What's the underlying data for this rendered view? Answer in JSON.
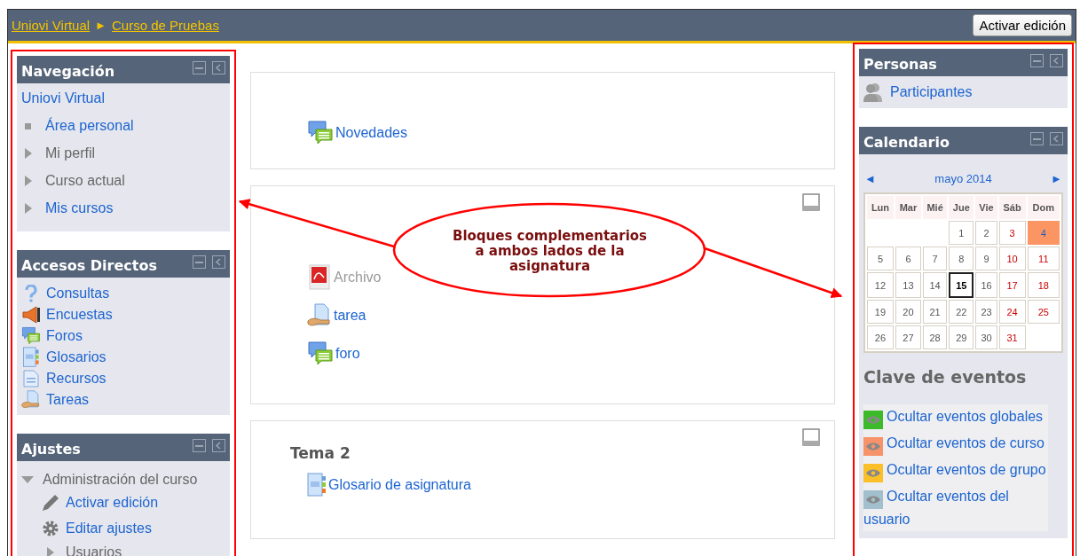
{
  "breadcrumb": [
    "Uniovi Virtual",
    "Curso de Pruebas"
  ],
  "breadcrumb_separator": "►",
  "edit_button": "Activar edición",
  "left_blocks": [
    {
      "kind": "navigation",
      "title": "Navegación",
      "items": [
        {
          "label": "Uniovi Virtual",
          "kind": "root",
          "link": true
        },
        {
          "label": "Área personal",
          "kind": "leaf",
          "link": true
        },
        {
          "label": "Mi perfil",
          "kind": "branch",
          "link": false
        },
        {
          "label": "Curso actual",
          "kind": "branch",
          "link": false
        },
        {
          "label": "Mis cursos",
          "kind": "branch",
          "link": true
        }
      ]
    },
    {
      "kind": "shortcuts",
      "title": "Accesos Directos",
      "items": [
        {
          "label": "Consultas",
          "kind": "question"
        },
        {
          "label": "Encuestas",
          "kind": "survey"
        },
        {
          "label": "Foros",
          "kind": "forum"
        },
        {
          "label": "Glosarios",
          "kind": "glossary"
        },
        {
          "label": "Recursos",
          "kind": "resource"
        },
        {
          "label": "Tareas",
          "kind": "assign"
        }
      ]
    },
    {
      "kind": "settings",
      "title": "Ajustes",
      "items": [
        {
          "label": "Administración del curso",
          "expanded": true,
          "children": [
            {
              "label": "Activar edición",
              "kind": "pencil"
            },
            {
              "label": "Editar ajustes",
              "kind": "gear"
            },
            {
              "label": "Usuarios",
              "kind": "collapsed"
            }
          ]
        }
      ]
    }
  ],
  "sections": [
    {
      "activities": [
        {
          "label": "Novedades",
          "kind": "forum",
          "dimmed": false
        }
      ]
    },
    {
      "activities": [
        {
          "label": "Archivo",
          "kind": "pdf",
          "dimmed": true
        },
        {
          "label": "tarea",
          "kind": "assign",
          "dimmed": false
        },
        {
          "label": "foro",
          "kind": "forum",
          "dimmed": false
        }
      ]
    },
    {
      "title": "Tema 2",
      "activities": [
        {
          "label": "Glosario de asignatura",
          "kind": "glossary",
          "dimmed": false
        }
      ]
    }
  ],
  "people": {
    "title": "Personas",
    "link": "Participantes"
  },
  "calendar": {
    "title": "Calendario",
    "prev": "◄",
    "month": "mayo 2014",
    "next": "►",
    "weekdays": [
      "Lun",
      "Mar",
      "Mié",
      "Jue",
      "Vie",
      "Sáb",
      "Dom"
    ],
    "weeks": [
      [
        {
          "kind": "blank"
        },
        {
          "kind": "blank"
        },
        {
          "kind": "blank"
        },
        {
          "day": "1"
        },
        {
          "day": "2"
        },
        {
          "day": "3"
        },
        {
          "day": "4",
          "event": true
        }
      ],
      [
        {
          "day": "5"
        },
        {
          "day": "6"
        },
        {
          "day": "7"
        },
        {
          "day": "8"
        },
        {
          "day": "9"
        },
        {
          "day": "10"
        },
        {
          "day": "11"
        }
      ],
      [
        {
          "day": "12"
        },
        {
          "day": "13"
        },
        {
          "day": "14"
        },
        {
          "day": "15",
          "today": true
        },
        {
          "day": "16"
        },
        {
          "day": "17"
        },
        {
          "day": "18"
        }
      ],
      [
        {
          "day": "19"
        },
        {
          "day": "20"
        },
        {
          "day": "21"
        },
        {
          "day": "22"
        },
        {
          "day": "23"
        },
        {
          "day": "24"
        },
        {
          "day": "25"
        }
      ],
      [
        {
          "day": "26"
        },
        {
          "day": "27"
        },
        {
          "day": "28"
        },
        {
          "day": "29"
        },
        {
          "day": "30"
        },
        {
          "day": "31"
        },
        {
          "kind": "blank"
        }
      ]
    ],
    "key_title": "Clave de eventos",
    "key": [
      {
        "label": "Ocultar eventos globales",
        "color": "#3dba2a"
      },
      {
        "label": "Ocultar eventos de curso",
        "color": "#f7936b"
      },
      {
        "label": "Ocultar eventos de grupo",
        "color": "#fbbf28"
      },
      {
        "label": "Ocultar eventos del usuario",
        "color": "#a1bfcc"
      }
    ]
  },
  "callout": "Bloques complementarios a ambos lados de la asignatura"
}
